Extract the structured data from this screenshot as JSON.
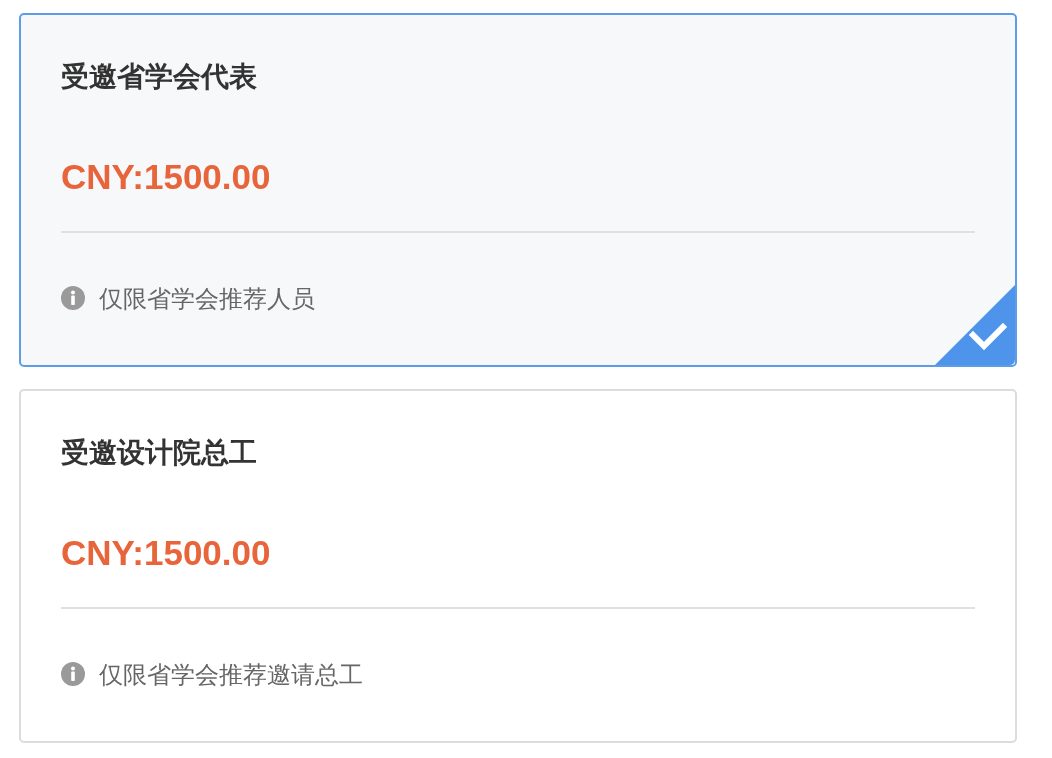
{
  "options": [
    {
      "title": "受邀省学会代表",
      "price": "CNY:1500.00",
      "note": "仅限省学会推荐人员",
      "selected": true
    },
    {
      "title": "受邀设计院总工",
      "price": "CNY:1500.00",
      "note": "仅限省学会推荐邀请总工",
      "selected": false
    }
  ]
}
